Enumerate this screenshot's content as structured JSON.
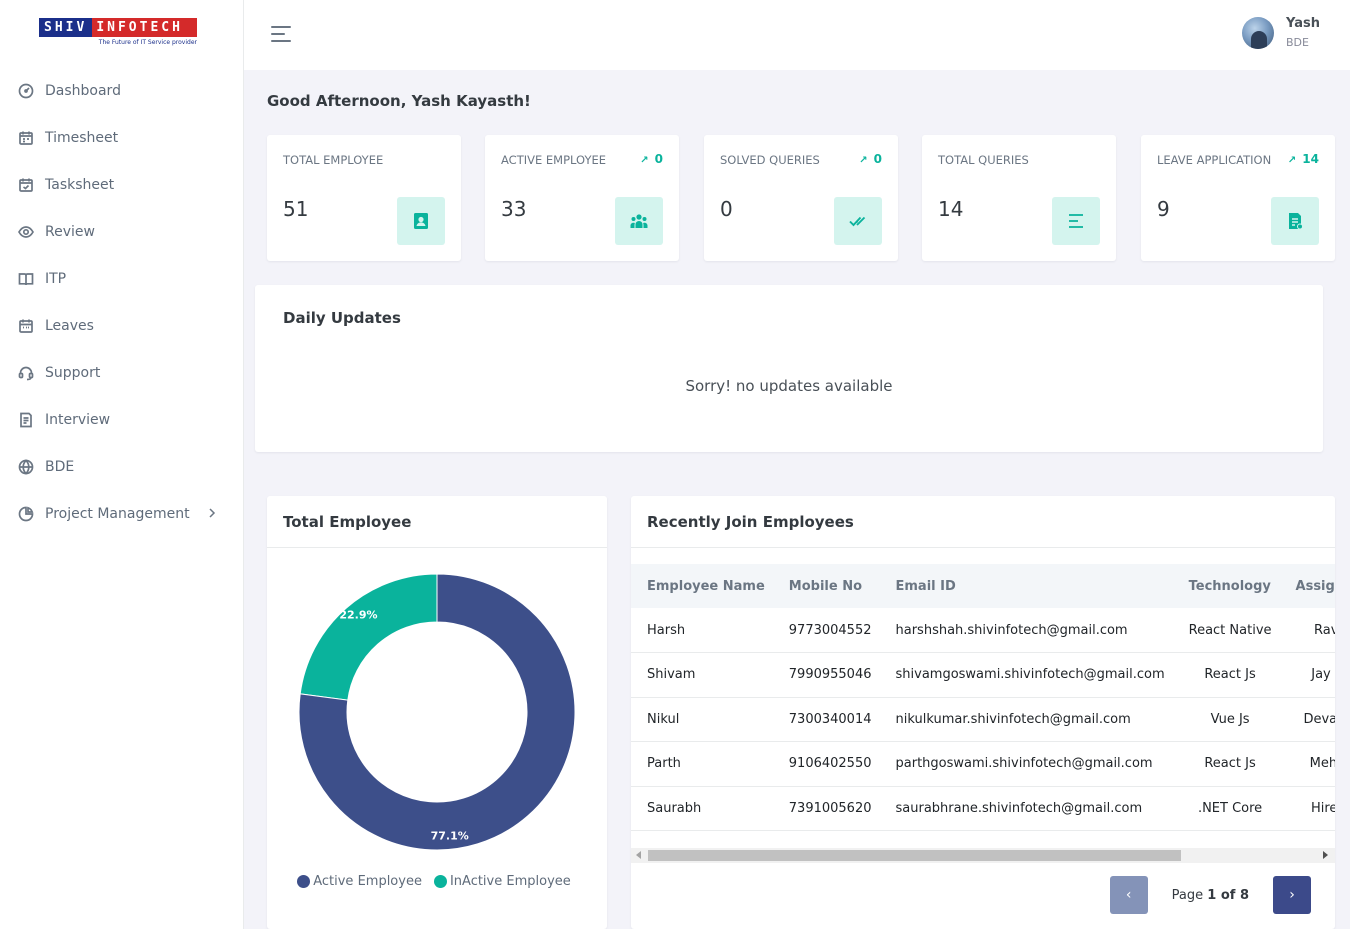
{
  "brand": {
    "name_left": "SHIV",
    "name_right": "INFOTECH",
    "tagline": "The Future of IT Service provider"
  },
  "sidebar": {
    "items": [
      {
        "label": "Dashboard",
        "icon": "dashboard-icon"
      },
      {
        "label": "Timesheet",
        "icon": "timesheet-icon"
      },
      {
        "label": "Tasksheet",
        "icon": "tasksheet-icon"
      },
      {
        "label": "Review",
        "icon": "eye-icon"
      },
      {
        "label": "ITP",
        "icon": "book-icon"
      },
      {
        "label": "Leaves",
        "icon": "calendar-icon"
      },
      {
        "label": "Support",
        "icon": "headset-icon"
      },
      {
        "label": "Interview",
        "icon": "document-icon"
      },
      {
        "label": "BDE",
        "icon": "globe-icon"
      },
      {
        "label": "Project Management",
        "icon": "pie-chart-icon"
      }
    ]
  },
  "user": {
    "name": "Yash",
    "role": "BDE"
  },
  "greeting": "Good Afternoon, Yash Kayasth!",
  "stats": [
    {
      "title": "TOTAL EMPLOYEE",
      "value": "51",
      "trend": "",
      "icon": "contact-card-icon"
    },
    {
      "title": "ACTIVE EMPLOYEE",
      "value": "33",
      "trend": "0",
      "icon": "group-icon"
    },
    {
      "title": "SOLVED QUERIES",
      "value": "0",
      "trend": "0",
      "icon": "double-check-icon"
    },
    {
      "title": "TOTAL QUERIES",
      "value": "14",
      "trend": "",
      "icon": "align-left-icon"
    },
    {
      "title": "LEAVE APPLICATION",
      "value": "9",
      "trend": "14",
      "icon": "file-list-icon"
    }
  ],
  "daily_updates": {
    "title": "Daily Updates",
    "empty_text": "Sorry! no updates available"
  },
  "total_employee": {
    "title": "Total Employee",
    "chart_data": {
      "type": "pie",
      "categories": [
        "Active Employee",
        "InActive Employee"
      ],
      "values": [
        77.1,
        22.9
      ],
      "labels": [
        "77.1%",
        "22.9%"
      ],
      "colors": [
        "#3d4f8a",
        "#0ab39c"
      ],
      "legend": "bottom"
    }
  },
  "recent": {
    "title": "Recently Join Employees",
    "columns": [
      "Employee Name",
      "Mobile No",
      "Email ID",
      "Technology",
      "Assigned S"
    ],
    "rows": [
      [
        "Harsh",
        "9773004552",
        "harshshah.shivinfotech@gmail.com",
        "React Native",
        "Ravi Du"
      ],
      [
        "Shivam",
        "7990955046",
        "shivamgoswami.shivinfotech@gmail.com",
        "React Js",
        "Jay Raya"
      ],
      [
        "Nikul",
        "7300340014",
        "nikulkumar.shivinfotech@gmail.com",
        "Vue Js",
        "Devang Ch"
      ],
      [
        "Parth",
        "9106402550",
        "parthgoswami.shivinfotech@gmail.com",
        "React Js",
        "Mehul Va"
      ],
      [
        "Saurabh",
        "7391005620",
        "saurabhrane.shivinfotech@gmail.com",
        ".NET Core",
        "Hiren Un"
      ]
    ],
    "pager": {
      "prefix": "Page ",
      "current": "1",
      "of": " of ",
      "total": "8",
      "prev": "‹",
      "next": "›"
    }
  }
}
